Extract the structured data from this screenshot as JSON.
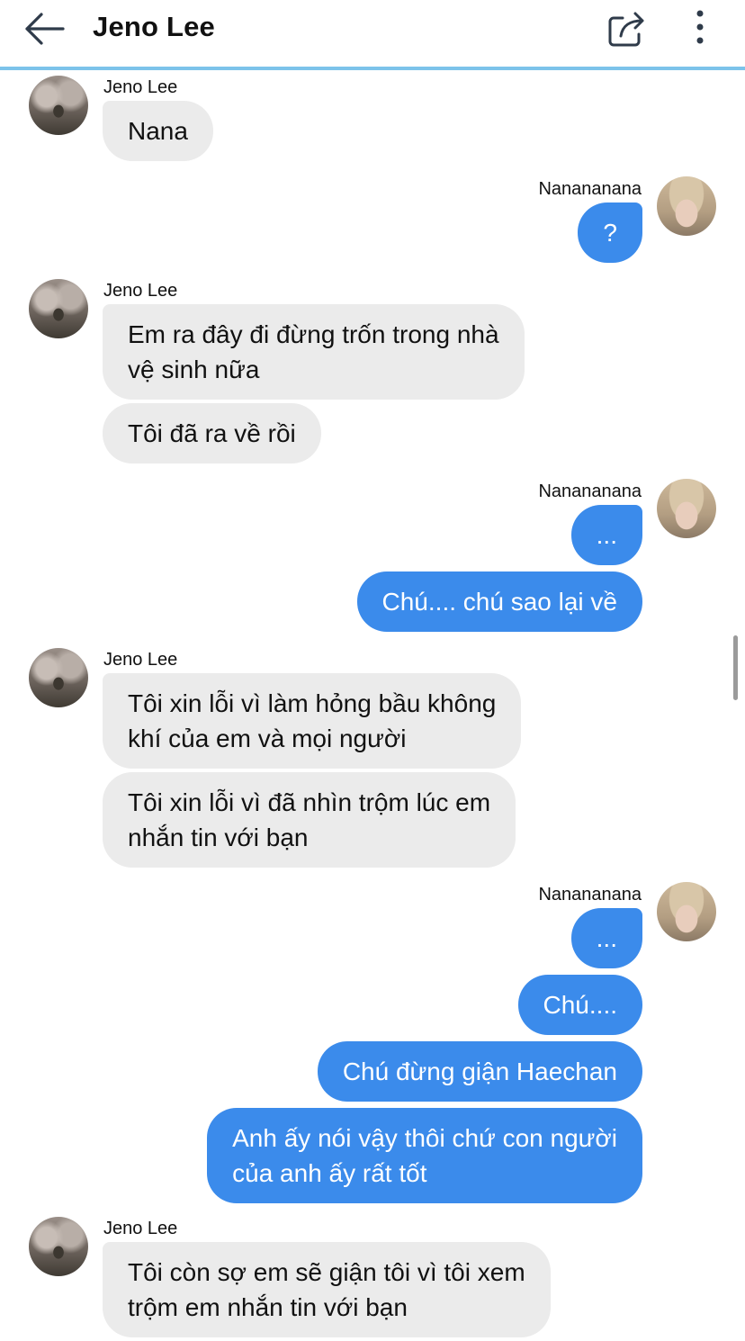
{
  "header": {
    "title": "Jeno Lee",
    "back_icon": "arrow-left-icon",
    "share_icon": "share-icon",
    "more_icon": "more-vertical-icon",
    "accent": "#7cc3ea"
  },
  "colors": {
    "incoming_bubble": "#ebebeb",
    "outgoing_bubble": "#3b8beb"
  },
  "messages": [
    {
      "sender": "Jeno Lee",
      "texts": [
        "Nana"
      ]
    },
    {
      "sender": "Nanananana",
      "texts": [
        "?"
      ]
    },
    {
      "sender": "Jeno Lee",
      "texts": [
        "Em ra đây đi đừng trốn trong nhà\nvệ sinh nữa",
        "Tôi đã ra về rồi"
      ]
    },
    {
      "sender": "Nanananana",
      "texts": [
        "...",
        "Chú.... chú sao lại về"
      ]
    },
    {
      "sender": "Jeno Lee",
      "texts": [
        "Tôi xin lỗi vì làm hỏng bầu không\nkhí của em và mọi người",
        "Tôi xin lỗi vì đã nhìn trộm lúc em\nnhắn tin với bạn"
      ]
    },
    {
      "sender": "Nanananana",
      "texts": [
        "...",
        "Chú....",
        "Chú đừng giận Haechan",
        "Anh ấy nói vậy thôi chứ con người\ncủa anh ấy rất tốt"
      ]
    },
    {
      "sender": "Jeno Lee",
      "texts": [
        "Tôi còn sợ em sẽ giận tôi vì tôi xem\ntrộm em nhắn tin với bạn"
      ]
    }
  ]
}
